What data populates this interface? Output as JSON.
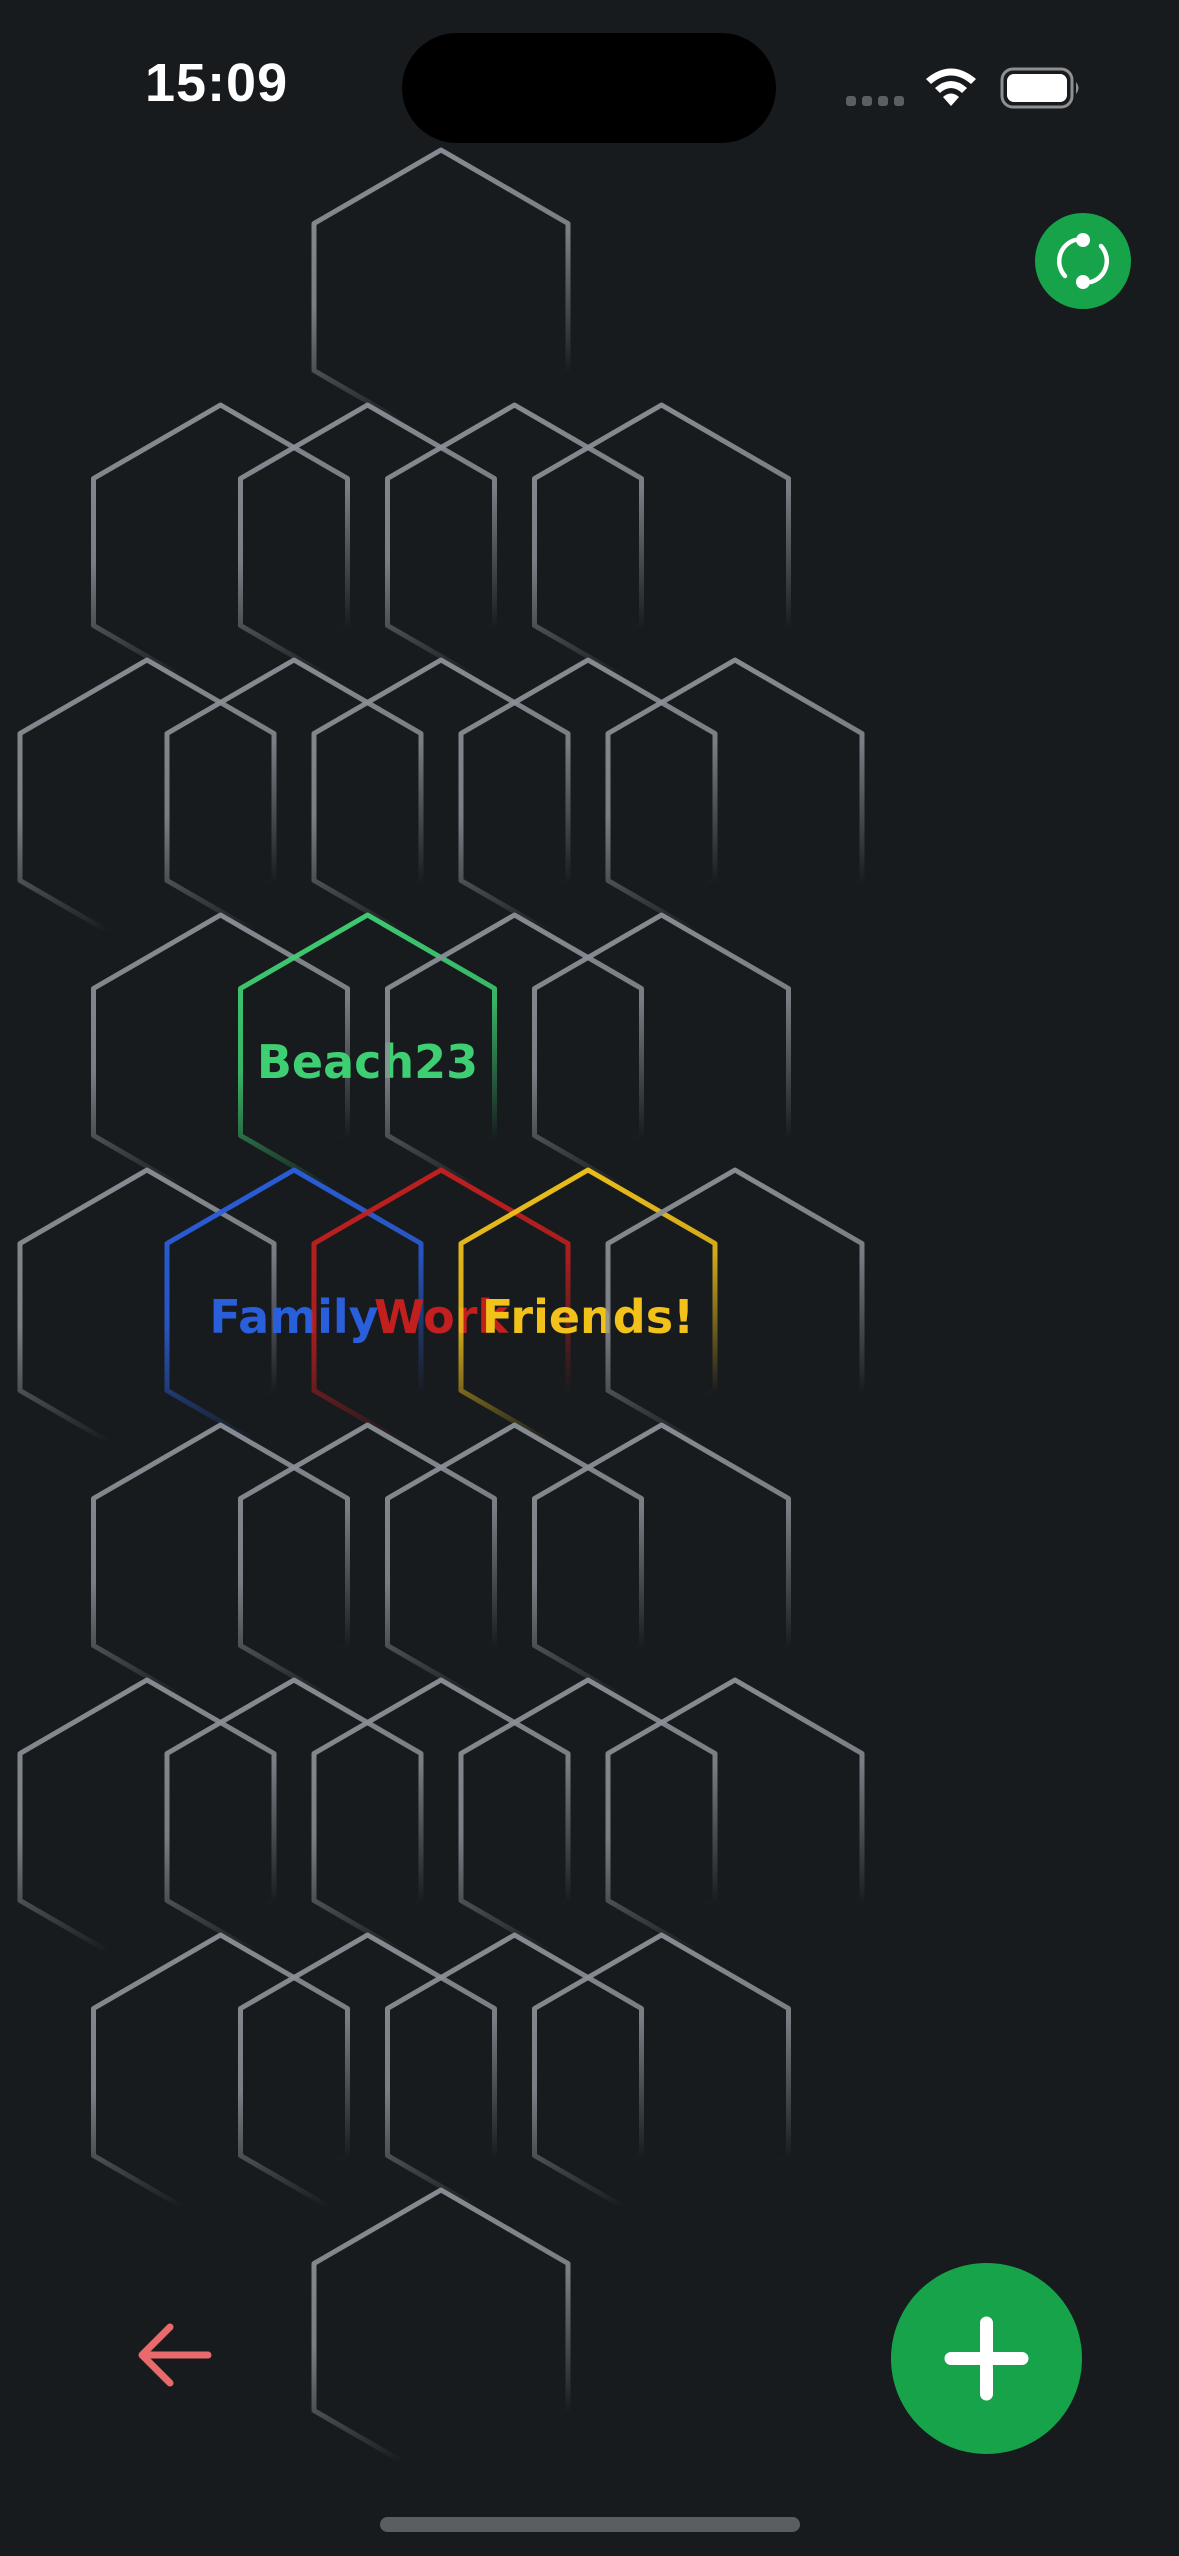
{
  "status_bar": {
    "time": "15:09"
  },
  "hex_groups": [
    {
      "label": "Beach23",
      "color": "#3fcf73"
    },
    {
      "label": "Family",
      "color": "#2a5fdc"
    },
    {
      "label": "Work",
      "color": "#c41f1f"
    },
    {
      "label": "Friends!",
      "color": "#f2c21a"
    }
  ],
  "colors": {
    "background": "#181b1e",
    "hex_outline": "#8a8f96",
    "accent_green": "#17a34a",
    "back_arrow": "#e86a6a"
  },
  "icons": {
    "sync": "sync-icon",
    "back": "arrow-left-icon",
    "add": "plus-icon"
  }
}
